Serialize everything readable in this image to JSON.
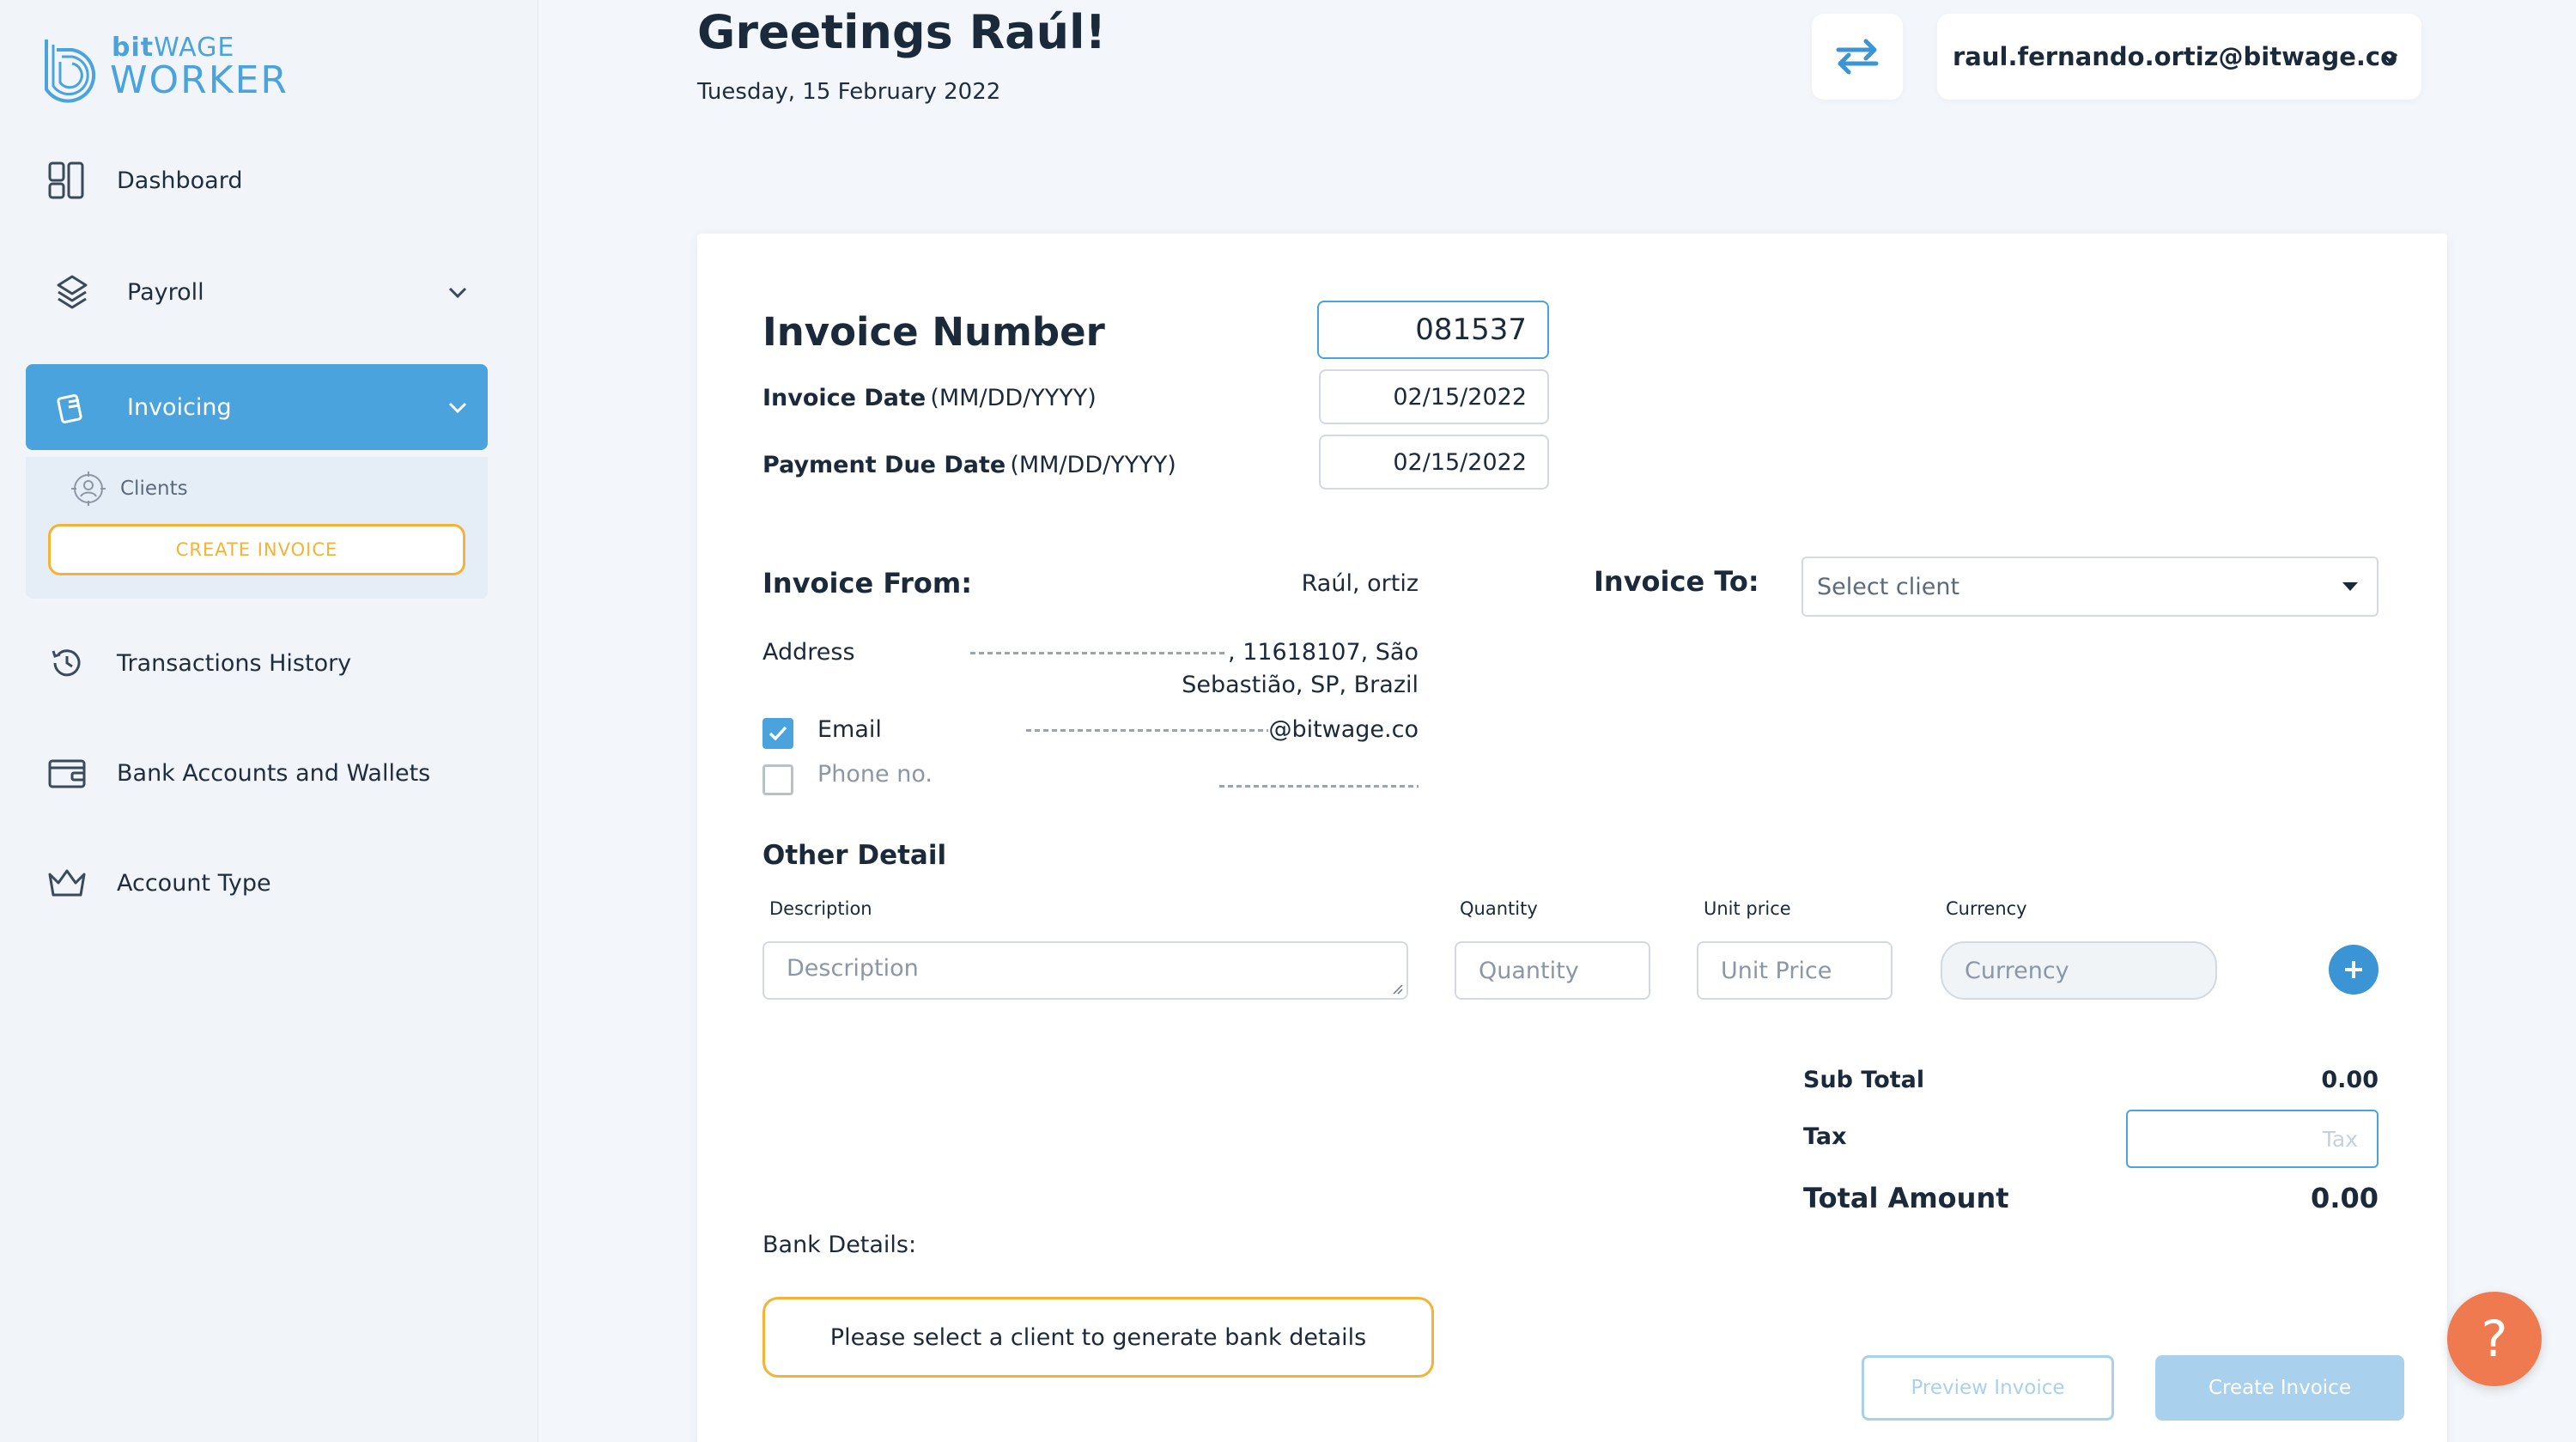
{
  "brand": {
    "small": "bitWAGE",
    "small_bold": "bit",
    "small_rest": "WAGE",
    "big": "WORKER",
    "color": "#4aa3dc"
  },
  "sidebar": {
    "items": [
      {
        "label": "Dashboard",
        "icon": "dashboard-icon"
      },
      {
        "label": "Payroll",
        "icon": "layers-icon",
        "expandable": true
      },
      {
        "label": "Invoicing",
        "icon": "invoice-icon",
        "expandable": true,
        "active": true
      },
      {
        "label": "Transactions History",
        "icon": "history-icon"
      },
      {
        "label": "Bank Accounts and Wallets",
        "icon": "wallet-icon"
      },
      {
        "label": "Account Type",
        "icon": "crown-icon"
      }
    ],
    "invoicing_sub": {
      "clients_label": "Clients",
      "create_invoice_label": "CREATE INVOICE"
    }
  },
  "header": {
    "greeting": "Greetings Raúl!",
    "date": "Tuesday, 15 February 2022",
    "user_email": "raul.fernando.ortiz@bitwage.co"
  },
  "invoice": {
    "number_label": "Invoice Number",
    "number_value": "081537",
    "date_label": "Invoice Date",
    "date_format": "(MM/DD/YYYY)",
    "date_value": "02/15/2022",
    "due_label": "Payment Due Date",
    "due_format": "(MM/DD/YYYY)",
    "due_value": "02/15/2022"
  },
  "from": {
    "heading": "Invoice From:",
    "name": "Raúl, ortiz",
    "address_label": "Address",
    "address_line1_visible": ", 11618107, São",
    "address_line2": "Sebastião, SP, Brazil",
    "email_label": "Email",
    "email_visible": "@bitwage.co",
    "email_checked": true,
    "phone_label": "Phone no.",
    "phone_checked": false
  },
  "to": {
    "heading": "Invoice To:",
    "select_placeholder": "Select client"
  },
  "other": {
    "heading": "Other Detail",
    "columns": {
      "description": "Description",
      "quantity": "Quantity",
      "unit_price": "Unit price",
      "currency": "Currency"
    },
    "placeholders": {
      "description": "Description",
      "quantity": "Quantity",
      "unit_price": "Unit Price",
      "currency": "Currency"
    }
  },
  "totals": {
    "subtotal_label": "Sub Total",
    "subtotal_value": "0.00",
    "tax_label": "Tax",
    "tax_placeholder": "Tax",
    "total_label": "Total Amount",
    "total_value": "0.00"
  },
  "bank": {
    "label": "Bank Details:",
    "message": "Please select a client to generate bank details"
  },
  "actions": {
    "preview": "Preview Invoice",
    "create": "Create Invoice",
    "help": "?"
  },
  "colors": {
    "accent": "#4aa3dc",
    "warning": "#f4b236",
    "help": "#f07a4f",
    "disabled": "#a9d1ee"
  }
}
